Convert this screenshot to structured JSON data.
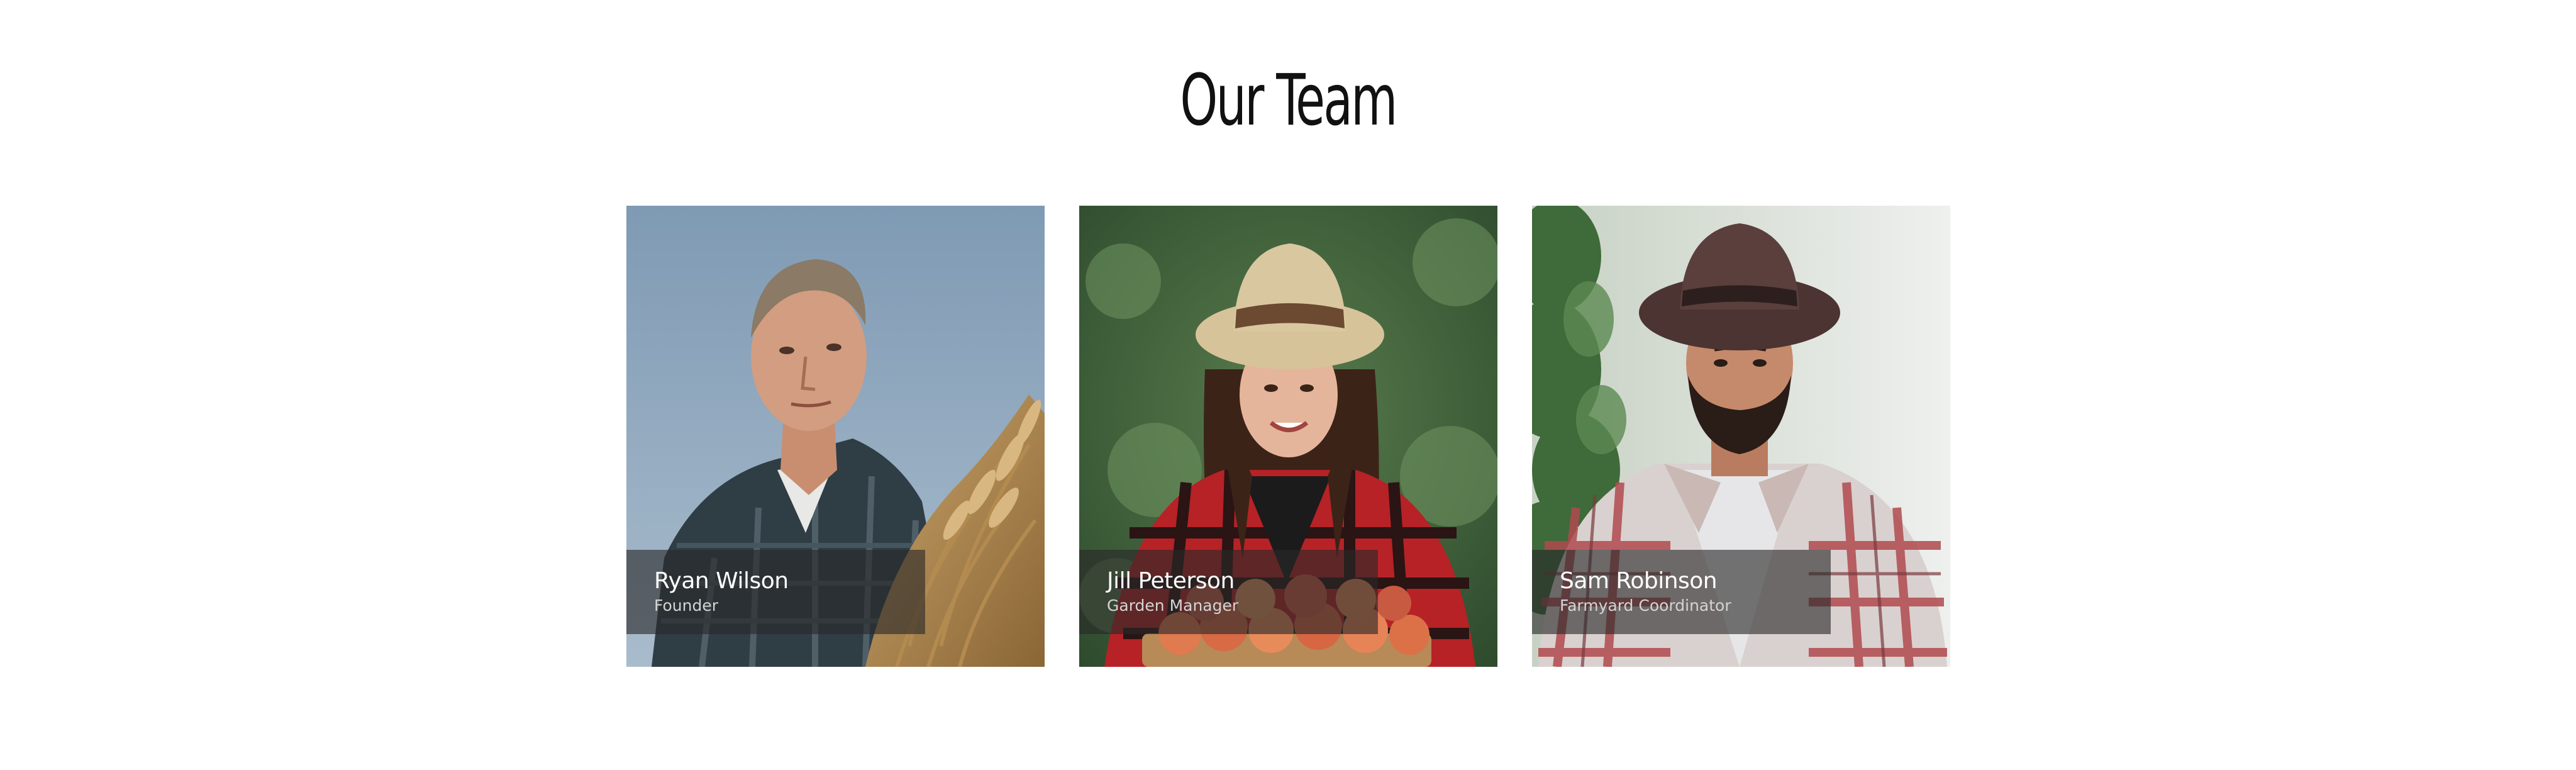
{
  "section": {
    "title": "Our Team"
  },
  "team": [
    {
      "name": "Ryan Wilson",
      "role": "Founder",
      "photo_icon": "farmer-with-wheat-photo"
    },
    {
      "name": "Jill Peterson",
      "role": "Garden Manager",
      "photo_icon": "woman-with-peaches-photo"
    },
    {
      "name": "Sam Robinson",
      "role": "Farmyard Coordinator",
      "photo_icon": "man-in-plaid-shirt-photo"
    }
  ],
  "colors": {
    "title": "#111111",
    "caption_overlay": "#282828",
    "caption_name": "#ffffff",
    "caption_role": "#d4d4d4"
  }
}
